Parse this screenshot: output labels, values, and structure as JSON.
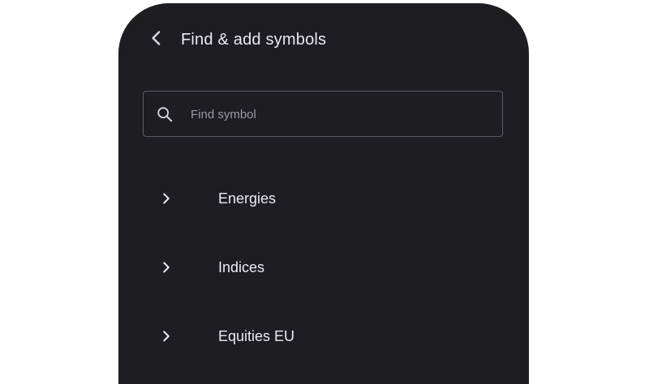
{
  "header": {
    "title": "Find & add symbols",
    "back_icon": "chevron-left-icon"
  },
  "search": {
    "placeholder": "Find symbol",
    "value": "",
    "icon": "search-icon"
  },
  "categories": [
    {
      "label": "Energies",
      "icon": "chevron-right-icon"
    },
    {
      "label": "Indices",
      "icon": "chevron-right-icon"
    },
    {
      "label": "Equities EU",
      "icon": "chevron-right-icon"
    }
  ],
  "colors": {
    "background": "#1e1d22",
    "text": "#eceaf0",
    "placeholder": "#9a989e",
    "border": "#5e5c63"
  }
}
